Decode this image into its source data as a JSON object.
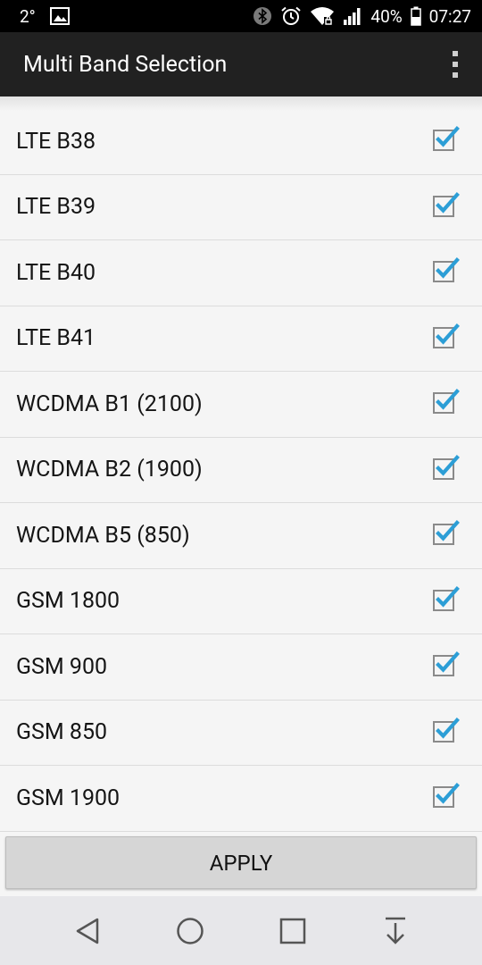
{
  "status_bar": {
    "temperature": "2°",
    "battery_percent": "40%",
    "time": "07:27",
    "icons": [
      "image-icon",
      "bluetooth-icon",
      "alarm-icon",
      "wifi-icon",
      "signal-icon",
      "battery-icon"
    ]
  },
  "toolbar": {
    "title": "Multi Band Selection",
    "overflow_icon": "overflow-menu-icon"
  },
  "bands": [
    {
      "label": "LTE B38",
      "checked": true
    },
    {
      "label": "LTE B39",
      "checked": true
    },
    {
      "label": "LTE B40",
      "checked": true
    },
    {
      "label": "LTE B41",
      "checked": true
    },
    {
      "label": "WCDMA B1 (2100)",
      "checked": true
    },
    {
      "label": "WCDMA B2 (1900)",
      "checked": true
    },
    {
      "label": "WCDMA B5 (850)",
      "checked": true
    },
    {
      "label": "GSM 1800",
      "checked": true
    },
    {
      "label": "GSM 900",
      "checked": true
    },
    {
      "label": "GSM 850",
      "checked": true
    },
    {
      "label": "GSM 1900",
      "checked": true
    }
  ],
  "apply_button": {
    "label": "APPLY"
  },
  "nav_bar": {
    "buttons": [
      "back-icon",
      "home-icon",
      "recents-icon",
      "notification-pull-icon"
    ]
  },
  "colors": {
    "check_accent": "#2c9ed6",
    "toolbar_bg": "#212121",
    "status_bg": "#000000"
  }
}
